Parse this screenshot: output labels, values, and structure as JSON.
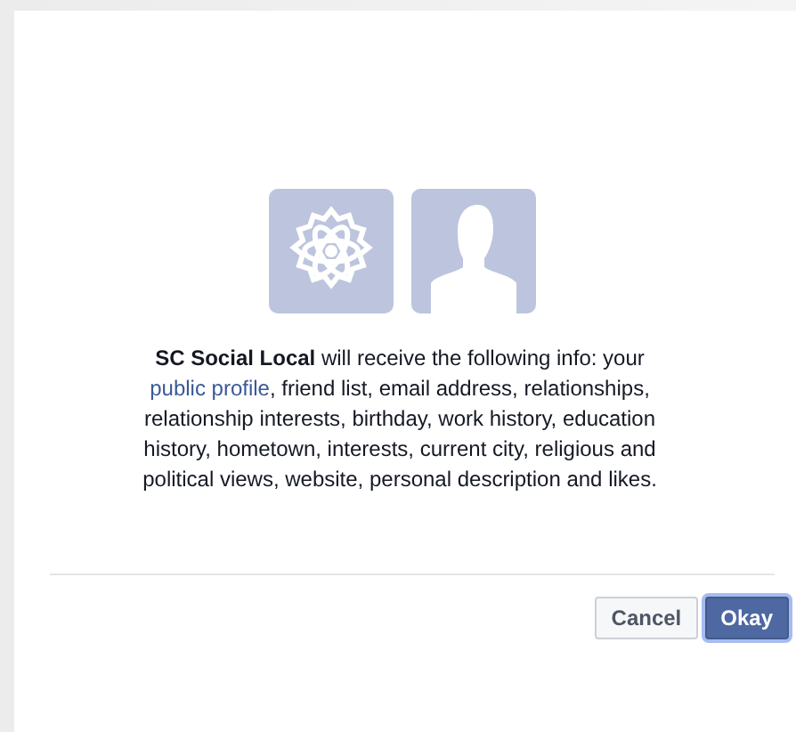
{
  "permission": {
    "intro": "**SC Social Local** will receive the following info: your",
    "link": "public profile",
    "rest": ", friend list, email address, relationships, relationship interests, birthday, work history, education history, hometown, interests, current city, religious and political views, website, personal description and likes."
  },
  "buttons": [
    {
      "label": "Cancel",
      "kind": "secondary"
    },
    {
      "label": "Okay",
      "kind": "primary"
    }
  ]
}
